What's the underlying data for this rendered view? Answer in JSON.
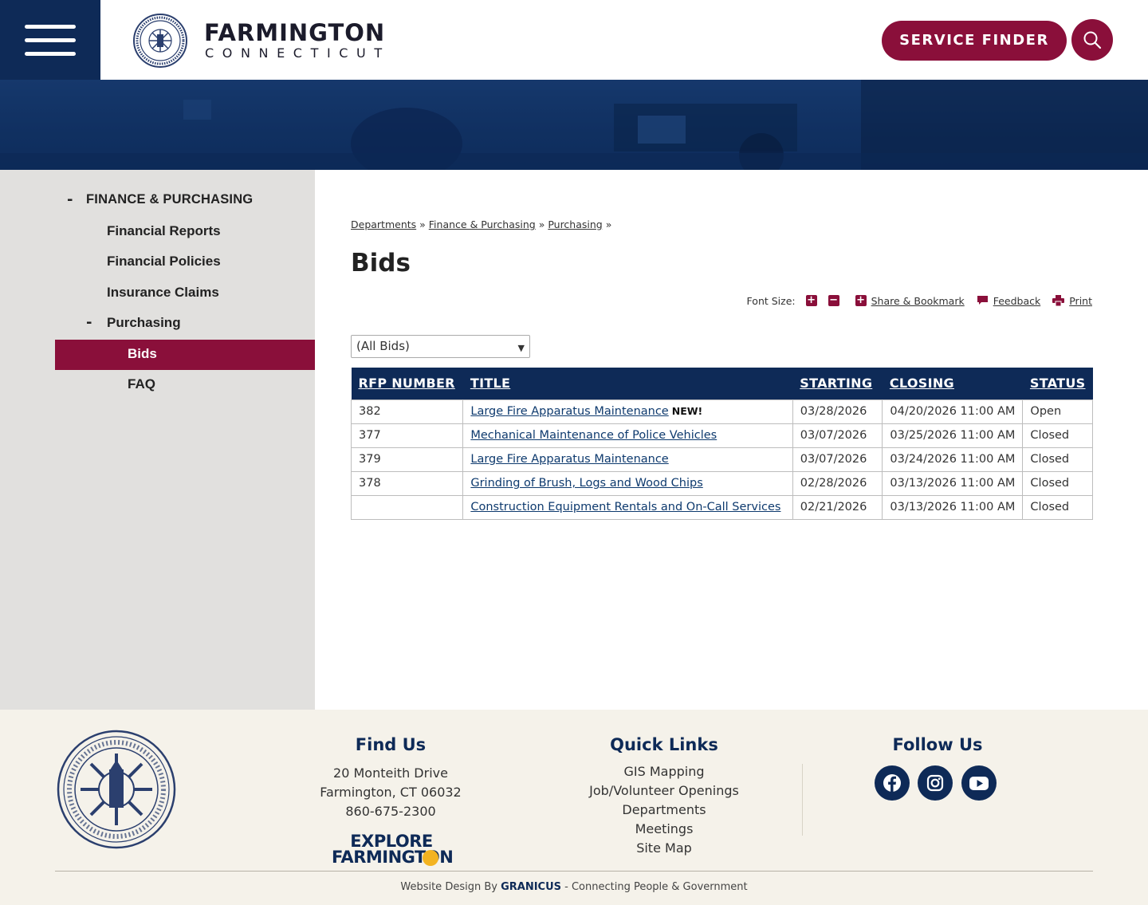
{
  "header": {
    "site_name": "FARMINGTON",
    "site_subtitle": "CONNECTICUT",
    "service_finder": "SERVICE FINDER"
  },
  "sidebar": {
    "section": {
      "toggle": "-",
      "label": "FINANCE & PURCHASING"
    },
    "items": [
      {
        "label": "Financial Reports"
      },
      {
        "label": "Financial Policies"
      },
      {
        "label": "Insurance Claims"
      },
      {
        "label": "Purchasing",
        "toggle": "-"
      },
      {
        "label": "Bids",
        "active": true
      },
      {
        "label": "FAQ"
      }
    ]
  },
  "breadcrumb": [
    {
      "label": "Departments"
    },
    {
      "label": "Finance & Purchasing"
    },
    {
      "label": "Purchasing"
    }
  ],
  "breadcrumb_sep": "»",
  "page_title": "Bids",
  "tools": {
    "font_size_label": "Font Size:",
    "increase": "+",
    "decrease": "−",
    "share": "Share & Bookmark",
    "feedback": "Feedback",
    "print": "Print"
  },
  "filter": {
    "selected": "(All Bids)"
  },
  "table": {
    "headers": [
      "RFP NUMBER",
      "TITLE",
      "STARTING",
      "CLOSING",
      "STATUS"
    ],
    "new_badge": "NEW!",
    "rows": [
      {
        "rfp": "382",
        "title": "Large Fire Apparatus Maintenance",
        "is_new": true,
        "starting": "03/28/2026",
        "closing": "04/20/2026 11:00 AM",
        "status": "Open"
      },
      {
        "rfp": "377",
        "title": "Mechanical Maintenance of Police Vehicles",
        "is_new": false,
        "starting": "03/07/2026",
        "closing": "03/25/2026 11:00 AM",
        "status": "Closed"
      },
      {
        "rfp": "379",
        "title": "Large Fire Apparatus Maintenance",
        "is_new": false,
        "starting": "03/07/2026",
        "closing": "03/24/2026 11:00 AM",
        "status": "Closed"
      },
      {
        "rfp": "378",
        "title": "Grinding of Brush, Logs and Wood Chips",
        "is_new": false,
        "starting": "02/28/2026",
        "closing": "03/13/2026 11:00 AM",
        "status": "Closed"
      },
      {
        "rfp": "",
        "title": "Construction Equipment Rentals and On-Call Services",
        "is_new": false,
        "starting": "02/21/2026",
        "closing": "03/13/2026 11:00 AM",
        "status": "Closed"
      }
    ]
  },
  "footer": {
    "find_us": {
      "heading": "Find Us",
      "address1": "20 Monteith Drive",
      "address2": "Farmington, CT 06032",
      "phone": "860-675-2300",
      "explore_line1": "EXPLORE",
      "explore_line2": "FARMINGTON"
    },
    "quick_links": {
      "heading": "Quick Links",
      "links": [
        "GIS Mapping",
        "Job/Volunteer Openings",
        "Departments",
        "Meetings",
        "Site Map"
      ]
    },
    "follow_us": {
      "heading": "Follow Us",
      "icons": [
        "facebook-icon",
        "instagram-icon",
        "youtube-icon"
      ]
    },
    "credit_prefix": "Website Design By",
    "credit_brand": "GRANICUS",
    "credit_suffix": "- Connecting People & Government"
  },
  "colors": {
    "navy": "#0e2a57",
    "maroon": "#8a0f3a",
    "sidebar_bg": "#e1e0de",
    "footer_bg": "#f5f2ea"
  }
}
